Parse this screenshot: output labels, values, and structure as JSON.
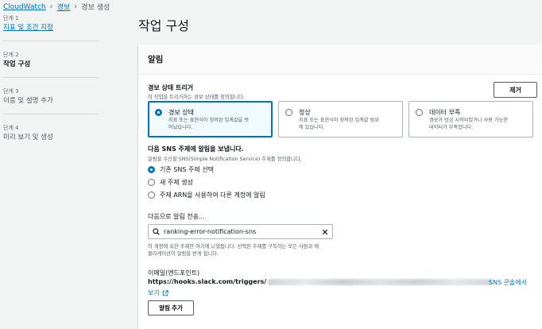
{
  "breadcrumb": {
    "root": "CloudWatch",
    "section": "경보",
    "current": "경보 생성"
  },
  "steps": [
    {
      "num": "단계 1",
      "label": "지표 및 조건 지정",
      "state": "link"
    },
    {
      "num": "단계 2",
      "label": "작업 구성",
      "state": "active"
    },
    {
      "num": "단계 3",
      "label": "이름 및 설명 추가",
      "state": "inactive"
    },
    {
      "num": "단계 4",
      "label": "미리 보기 및 생성",
      "state": "inactive"
    }
  ],
  "page_title": "작업 구성",
  "panel": {
    "title": "알림",
    "remove_label": "제거",
    "trigger": {
      "label": "경보 상태 트리거",
      "desc": "이 작업을 트리거하는 경보 상태를 정의합니다.",
      "options": [
        {
          "title": "경보 상태",
          "desc1": "지표 또는 표현식이 정의된 임계값을 벗",
          "desc2": "어났습니다.",
          "selected": true
        },
        {
          "title": "정상",
          "desc1": "지표 또는 표현식이 정의된 임계값 범위",
          "desc2": "에 있습니다.",
          "selected": false
        },
        {
          "title": "데이터 부족",
          "desc1": "경보가 방금 시작되었거나 사용 가능한",
          "desc2": "데이터가 부족합니다.",
          "selected": false
        }
      ]
    },
    "sns": {
      "label": "다음 SNS 주제에 알림을 보냅니다.",
      "desc": "알림을 수신할 SNS(Simple Notification Service) 주제를 정의합니다.",
      "options": [
        {
          "label": "기존 SNS 주제 선택",
          "selected": true
        },
        {
          "label": "새 주제 생성",
          "selected": false
        },
        {
          "label": "주제 ARN을 사용하여 다른 계정에 알림",
          "selected": false
        }
      ]
    },
    "send_to": {
      "label": "다음으로 알림 전송...",
      "value": "ranking-error-notification-sns",
      "desc1": "이 계정에 속한 주제만 여기에 나열됩니다. 선택된 주제를 구독하는 모든 사람과 애",
      "desc2": "플리케이션이 알림을 받게 됩니다."
    },
    "email": {
      "label": "이메일(엔드포인트)",
      "endpoint_prefix": "https://hooks.slack.com/triggers/",
      "console_link_1": "SNS 콘솔에서",
      "console_link_2": "보기"
    },
    "add_label": "알림 추가"
  }
}
